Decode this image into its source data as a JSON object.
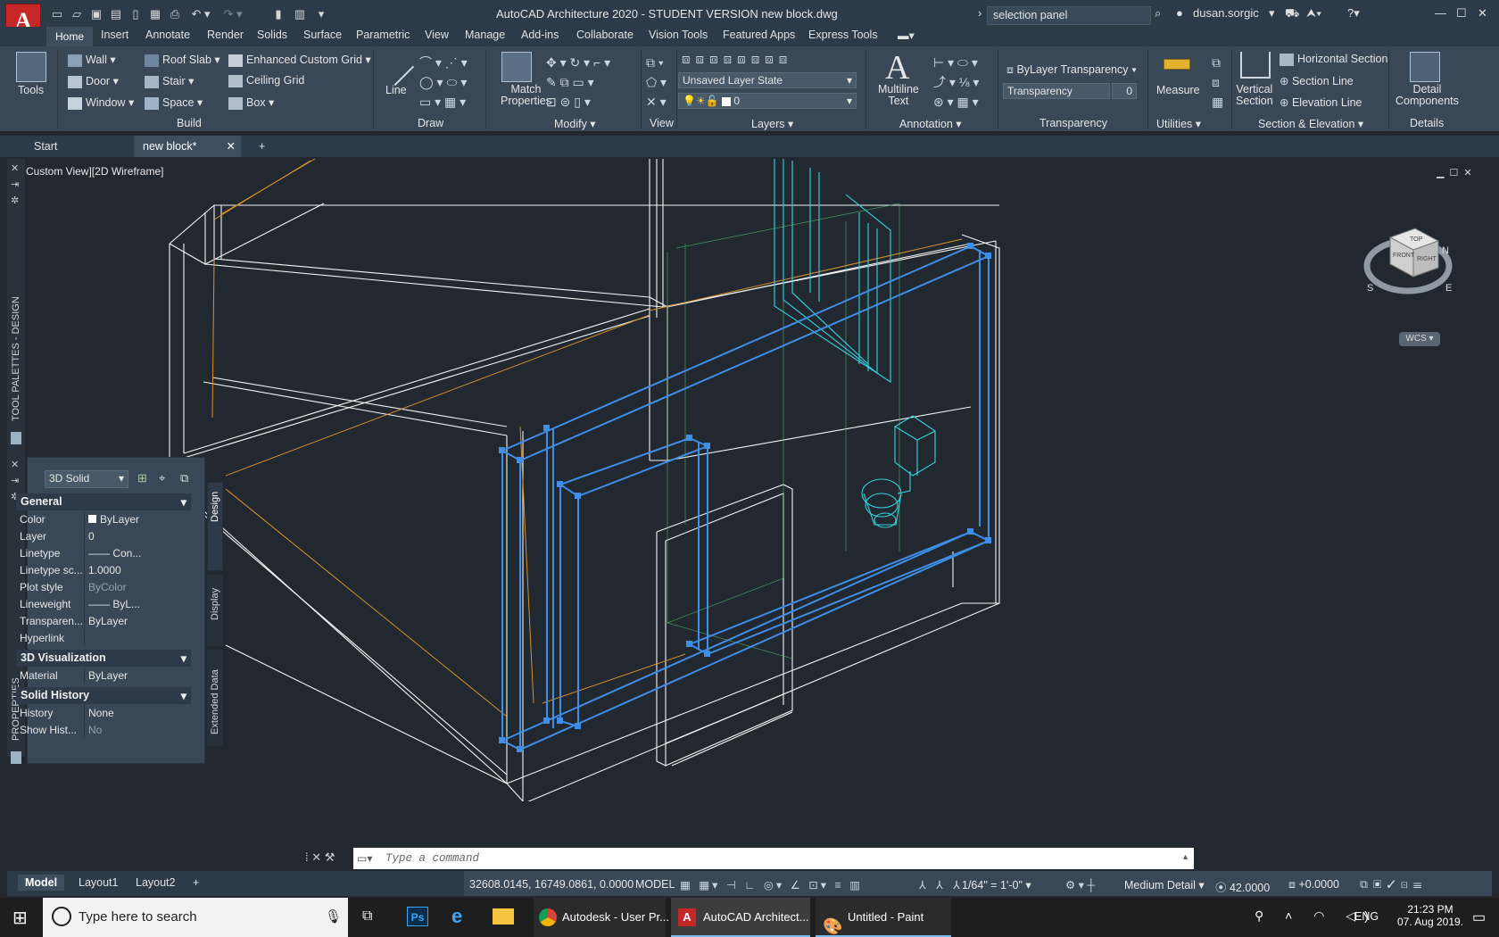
{
  "app": {
    "logo": "A",
    "title": "AutoCAD Architecture 2020 - STUDENT VERSION    new block.dwg",
    "search_value": "selection panel",
    "user": "dusan.sorgic"
  },
  "menu_tabs": [
    "Home",
    "Insert",
    "Annotate",
    "Render",
    "Solids",
    "Surface",
    "Parametric",
    "View",
    "Manage",
    "Add-ins",
    "Collaborate",
    "Vision Tools",
    "Featured Apps",
    "Express Tools"
  ],
  "ribbon": {
    "tools_label": "Tools",
    "build": {
      "title": "Build",
      "items": [
        "Wall",
        "Door",
        "Window",
        "Roof Slab",
        "Stair",
        "Space",
        "Enhanced Custom Grid",
        "Ceiling Grid",
        "Box"
      ]
    },
    "draw": {
      "title": "Draw",
      "line_label": "Line"
    },
    "modify": {
      "title": "Modify",
      "match_label": "Match",
      "match_label2": "Properties"
    },
    "view": {
      "title": "View"
    },
    "layers": {
      "title": "Layers",
      "layer_state": "Unsaved Layer State",
      "current_layer": "0"
    },
    "annotation": {
      "title": "Annotation",
      "mtext1": "Multiline",
      "mtext2": "Text"
    },
    "transparency": {
      "title": "Transparency",
      "bylayer": "ByLayer Transparency",
      "label": "Transparency",
      "value": "0"
    },
    "utilities": {
      "title": "Utilities",
      "measure": "Measure"
    },
    "section": {
      "title": "Section & Elevation",
      "vert1": "Vertical",
      "vert2": "Section",
      "hsec": "Horizontal Section",
      "sline": "Section Line",
      "eline": "Elevation Line"
    },
    "details": {
      "title": "Details",
      "d1": "Detail",
      "d2": "Components"
    }
  },
  "file_tabs": {
    "start": "Start",
    "active": "new block*"
  },
  "viewport": {
    "label": "Custom View][2D Wireframe]"
  },
  "left_strip": {
    "tool_palettes": "TOOL PALETTES - DESIGN",
    "properties": "PROPERTIES"
  },
  "properties": {
    "object_type": "3D Solid",
    "general_title": "General",
    "general": [
      [
        "Color",
        "ByLayer"
      ],
      [
        "Layer",
        "0"
      ],
      [
        "Linetype",
        "—— Con..."
      ],
      [
        "Linetype sc...",
        "1.0000"
      ],
      [
        "Plot style",
        "ByColor"
      ],
      [
        "Lineweight",
        "—— ByL..."
      ],
      [
        "Transparen...",
        "ByLayer"
      ],
      [
        "Hyperlink",
        ""
      ]
    ],
    "viz_title": "3D Visualization",
    "viz": [
      [
        "Material",
        "ByLayer"
      ]
    ],
    "hist_title": "Solid History",
    "hist": [
      [
        "History",
        "None"
      ],
      [
        "Show Hist...",
        "No"
      ]
    ],
    "side_tabs": [
      "Design",
      "Display",
      "Extended Data"
    ]
  },
  "viewcube": {
    "top": "TOP",
    "front": "FRONT",
    "right": "RIGHT",
    "n": "N",
    "e": "E",
    "s": "S",
    "wcs": "WCS"
  },
  "command": {
    "placeholder": "Type  a  command"
  },
  "layout_tabs": [
    "Model",
    "Layout1",
    "Layout2"
  ],
  "status": {
    "coords": "32608.0145, 16749.0861, 0.0000",
    "model": "MODEL",
    "scale": "1/64\" = 1'-0\"",
    "detail": "Medium Detail",
    "elev": "42.0000",
    "offset": "+0.0000"
  },
  "taskbar": {
    "search": "Type here to search",
    "apps": [
      "Autodesk - User Pr...",
      "AutoCAD Architect...",
      "Untitled - Paint"
    ],
    "lang": "ENG",
    "time": "21:23 PM",
    "date": "07. Aug 2019."
  },
  "colors": {
    "accent": "#3f8ee8",
    "wire": "#ffffff",
    "cyan": "#35d5e0",
    "orange": "#d8902d",
    "green": "#54b86b"
  }
}
